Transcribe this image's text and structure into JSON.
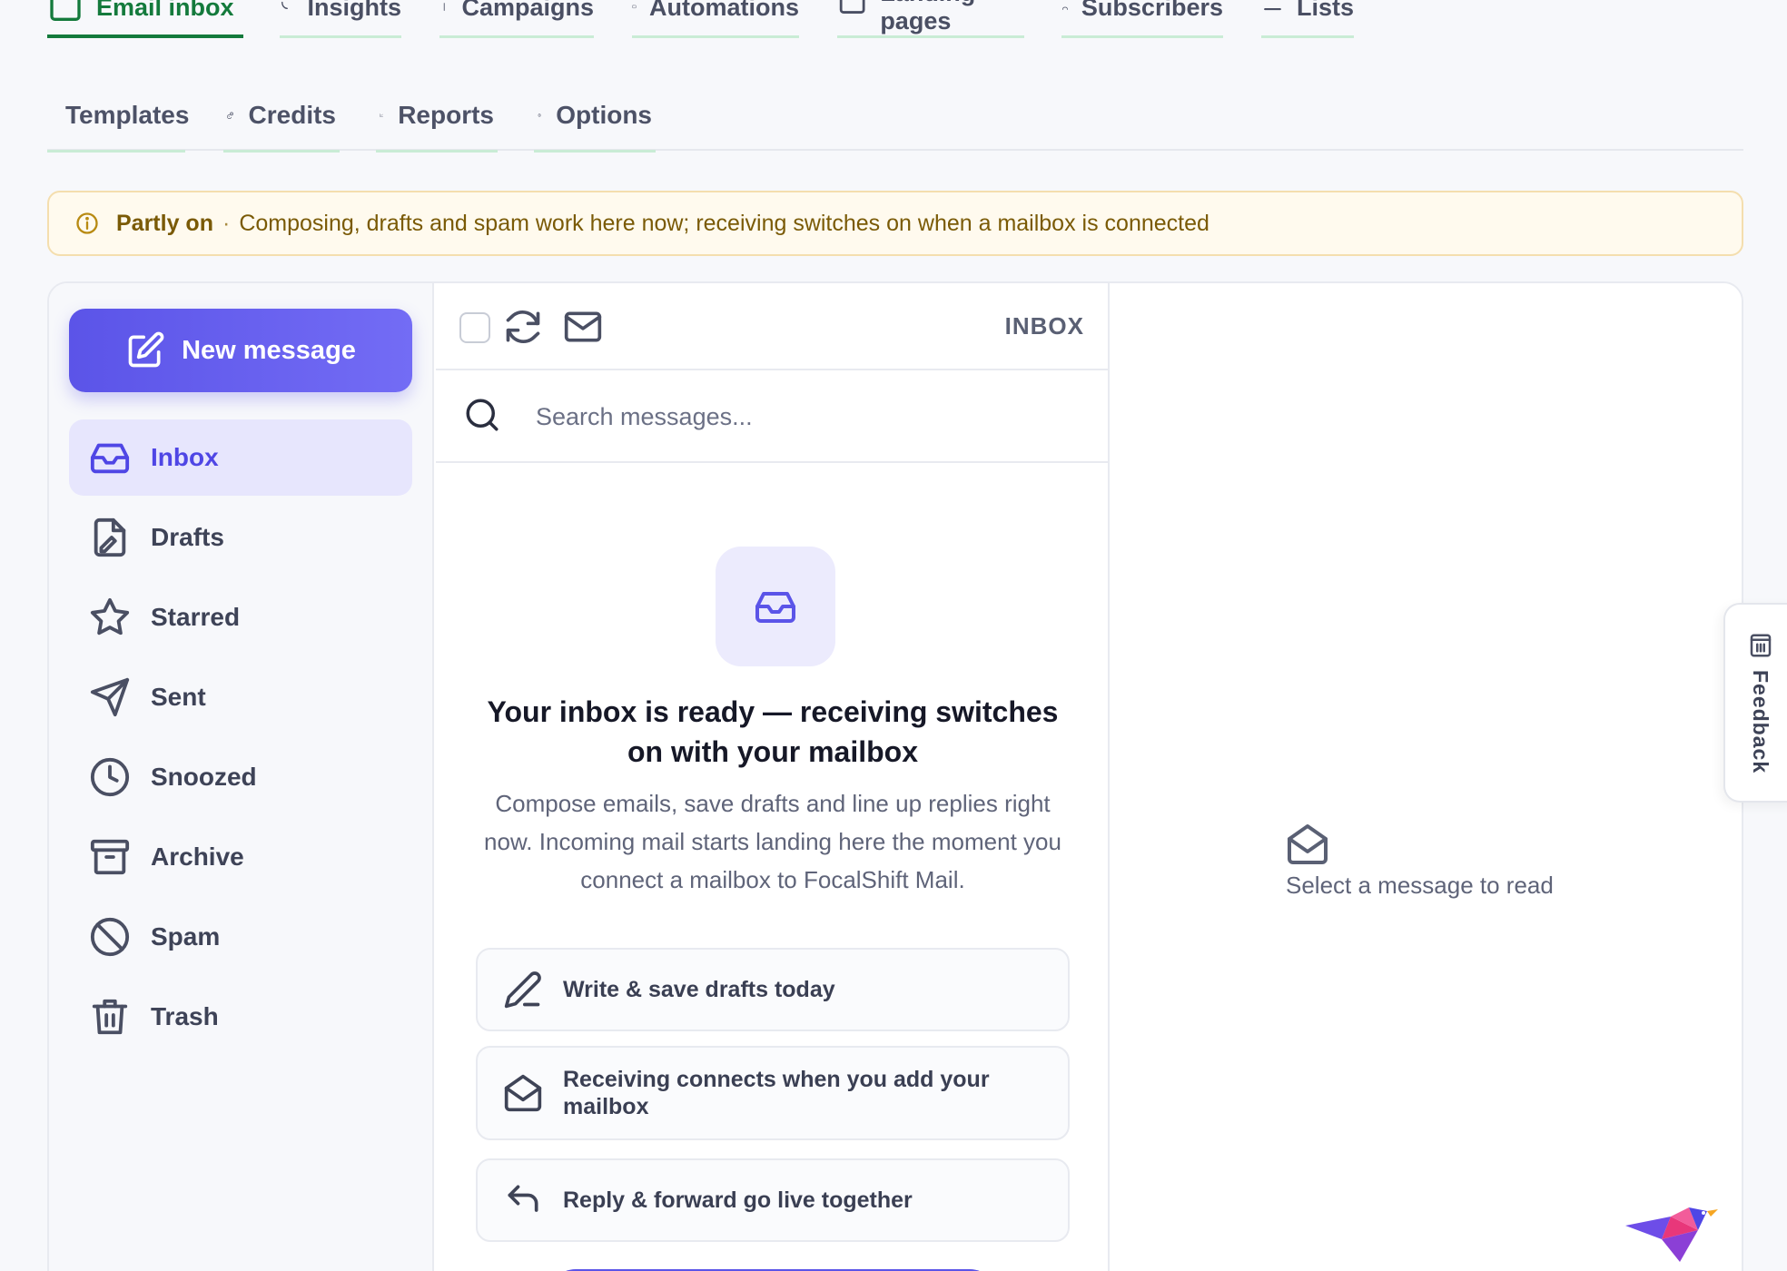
{
  "nav_primary": [
    {
      "label": "Email inbox",
      "icon": "inbox-icon",
      "active": true
    },
    {
      "label": "Insights",
      "icon": "insights-icon"
    },
    {
      "label": "Campaigns",
      "icon": "campaign-icon"
    },
    {
      "label": "Automations",
      "icon": "automation-icon"
    },
    {
      "label": "Landing pages",
      "icon": "landing-page-icon"
    },
    {
      "label": "Subscribers",
      "icon": "users-icon"
    },
    {
      "label": "Lists",
      "icon": "list-icon"
    }
  ],
  "nav_secondary": [
    {
      "label": "Templates",
      "icon": "document-icon"
    },
    {
      "label": "Credits",
      "icon": "credits-icon"
    },
    {
      "label": "Reports",
      "icon": "chart-icon"
    },
    {
      "label": "Options",
      "icon": "gear-icon"
    }
  ],
  "banner": {
    "status": "Partly on",
    "separator": "·",
    "message": "Composing, drafts and spam work here now; receiving switches on when a mailbox is connected",
    "color": "#fffaee"
  },
  "sidebar": {
    "compose_label": "New message",
    "folders": [
      {
        "label": "Inbox",
        "icon": "inbox-icon",
        "active": true
      },
      {
        "label": "Drafts",
        "icon": "drafts-icon"
      },
      {
        "label": "Starred",
        "icon": "star-icon"
      },
      {
        "label": "Sent",
        "icon": "send-icon"
      },
      {
        "label": "Snoozed",
        "icon": "clock-icon"
      },
      {
        "label": "Archive",
        "icon": "archive-icon"
      },
      {
        "label": "Spam",
        "icon": "block-icon"
      },
      {
        "label": "Trash",
        "icon": "trash-icon"
      }
    ]
  },
  "list": {
    "folder_label": "INBOX",
    "search_placeholder": "Search messages...",
    "empty_title": "Your inbox is ready — receiving switches on with your mailbox",
    "empty_desc": "Compose emails, save drafts and line up replies right now. Incoming mail starts landing here the moment you connect a mailbox to FocalShift Mail.",
    "features": [
      {
        "label": "Write & save drafts today",
        "icon": "pencil-icon"
      },
      {
        "label": "Receiving connects when you add your mailbox",
        "icon": "mail-open-icon"
      },
      {
        "label": "Reply & forward go live together",
        "icon": "reply-icon"
      }
    ]
  },
  "reader": {
    "empty_text": "Select a message to read"
  },
  "feedback": {
    "label": "Feedback"
  },
  "colors": {
    "accent": "#5b54e8",
    "nav_active": "#147a3c",
    "banner_text": "#7a5a06"
  }
}
